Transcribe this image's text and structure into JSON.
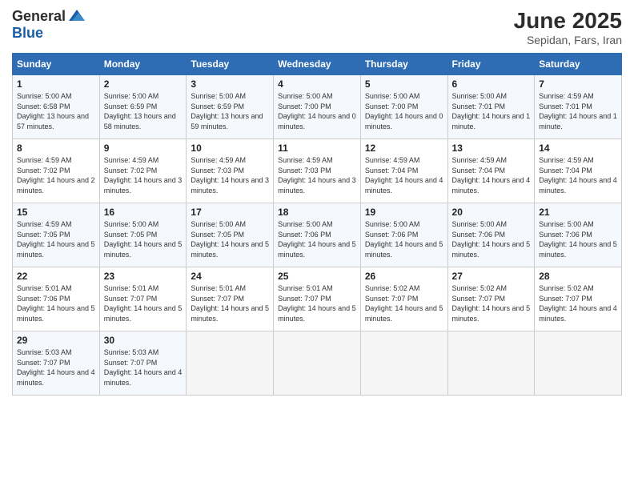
{
  "header": {
    "logo_general": "General",
    "logo_blue": "Blue",
    "title": "June 2025",
    "location": "Sepidan, Fars, Iran"
  },
  "weekdays": [
    "Sunday",
    "Monday",
    "Tuesday",
    "Wednesday",
    "Thursday",
    "Friday",
    "Saturday"
  ],
  "weeks": [
    [
      {
        "day": "1",
        "sunrise": "Sunrise: 5:00 AM",
        "sunset": "Sunset: 6:58 PM",
        "daylight": "Daylight: 13 hours and 57 minutes."
      },
      {
        "day": "2",
        "sunrise": "Sunrise: 5:00 AM",
        "sunset": "Sunset: 6:59 PM",
        "daylight": "Daylight: 13 hours and 58 minutes."
      },
      {
        "day": "3",
        "sunrise": "Sunrise: 5:00 AM",
        "sunset": "Sunset: 6:59 PM",
        "daylight": "Daylight: 13 hours and 59 minutes."
      },
      {
        "day": "4",
        "sunrise": "Sunrise: 5:00 AM",
        "sunset": "Sunset: 7:00 PM",
        "daylight": "Daylight: 14 hours and 0 minutes."
      },
      {
        "day": "5",
        "sunrise": "Sunrise: 5:00 AM",
        "sunset": "Sunset: 7:00 PM",
        "daylight": "Daylight: 14 hours and 0 minutes."
      },
      {
        "day": "6",
        "sunrise": "Sunrise: 5:00 AM",
        "sunset": "Sunset: 7:01 PM",
        "daylight": "Daylight: 14 hours and 1 minute."
      },
      {
        "day": "7",
        "sunrise": "Sunrise: 4:59 AM",
        "sunset": "Sunset: 7:01 PM",
        "daylight": "Daylight: 14 hours and 1 minute."
      }
    ],
    [
      {
        "day": "8",
        "sunrise": "Sunrise: 4:59 AM",
        "sunset": "Sunset: 7:02 PM",
        "daylight": "Daylight: 14 hours and 2 minutes."
      },
      {
        "day": "9",
        "sunrise": "Sunrise: 4:59 AM",
        "sunset": "Sunset: 7:02 PM",
        "daylight": "Daylight: 14 hours and 3 minutes."
      },
      {
        "day": "10",
        "sunrise": "Sunrise: 4:59 AM",
        "sunset": "Sunset: 7:03 PM",
        "daylight": "Daylight: 14 hours and 3 minutes."
      },
      {
        "day": "11",
        "sunrise": "Sunrise: 4:59 AM",
        "sunset": "Sunset: 7:03 PM",
        "daylight": "Daylight: 14 hours and 3 minutes."
      },
      {
        "day": "12",
        "sunrise": "Sunrise: 4:59 AM",
        "sunset": "Sunset: 7:04 PM",
        "daylight": "Daylight: 14 hours and 4 minutes."
      },
      {
        "day": "13",
        "sunrise": "Sunrise: 4:59 AM",
        "sunset": "Sunset: 7:04 PM",
        "daylight": "Daylight: 14 hours and 4 minutes."
      },
      {
        "day": "14",
        "sunrise": "Sunrise: 4:59 AM",
        "sunset": "Sunset: 7:04 PM",
        "daylight": "Daylight: 14 hours and 4 minutes."
      }
    ],
    [
      {
        "day": "15",
        "sunrise": "Sunrise: 4:59 AM",
        "sunset": "Sunset: 7:05 PM",
        "daylight": "Daylight: 14 hours and 5 minutes."
      },
      {
        "day": "16",
        "sunrise": "Sunrise: 5:00 AM",
        "sunset": "Sunset: 7:05 PM",
        "daylight": "Daylight: 14 hours and 5 minutes."
      },
      {
        "day": "17",
        "sunrise": "Sunrise: 5:00 AM",
        "sunset": "Sunset: 7:05 PM",
        "daylight": "Daylight: 14 hours and 5 minutes."
      },
      {
        "day": "18",
        "sunrise": "Sunrise: 5:00 AM",
        "sunset": "Sunset: 7:06 PM",
        "daylight": "Daylight: 14 hours and 5 minutes."
      },
      {
        "day": "19",
        "sunrise": "Sunrise: 5:00 AM",
        "sunset": "Sunset: 7:06 PM",
        "daylight": "Daylight: 14 hours and 5 minutes."
      },
      {
        "day": "20",
        "sunrise": "Sunrise: 5:00 AM",
        "sunset": "Sunset: 7:06 PM",
        "daylight": "Daylight: 14 hours and 5 minutes."
      },
      {
        "day": "21",
        "sunrise": "Sunrise: 5:00 AM",
        "sunset": "Sunset: 7:06 PM",
        "daylight": "Daylight: 14 hours and 5 minutes."
      }
    ],
    [
      {
        "day": "22",
        "sunrise": "Sunrise: 5:01 AM",
        "sunset": "Sunset: 7:06 PM",
        "daylight": "Daylight: 14 hours and 5 minutes."
      },
      {
        "day": "23",
        "sunrise": "Sunrise: 5:01 AM",
        "sunset": "Sunset: 7:07 PM",
        "daylight": "Daylight: 14 hours and 5 minutes."
      },
      {
        "day": "24",
        "sunrise": "Sunrise: 5:01 AM",
        "sunset": "Sunset: 7:07 PM",
        "daylight": "Daylight: 14 hours and 5 minutes."
      },
      {
        "day": "25",
        "sunrise": "Sunrise: 5:01 AM",
        "sunset": "Sunset: 7:07 PM",
        "daylight": "Daylight: 14 hours and 5 minutes."
      },
      {
        "day": "26",
        "sunrise": "Sunrise: 5:02 AM",
        "sunset": "Sunset: 7:07 PM",
        "daylight": "Daylight: 14 hours and 5 minutes."
      },
      {
        "day": "27",
        "sunrise": "Sunrise: 5:02 AM",
        "sunset": "Sunset: 7:07 PM",
        "daylight": "Daylight: 14 hours and 5 minutes."
      },
      {
        "day": "28",
        "sunrise": "Sunrise: 5:02 AM",
        "sunset": "Sunset: 7:07 PM",
        "daylight": "Daylight: 14 hours and 4 minutes."
      }
    ],
    [
      {
        "day": "29",
        "sunrise": "Sunrise: 5:03 AM",
        "sunset": "Sunset: 7:07 PM",
        "daylight": "Daylight: 14 hours and 4 minutes."
      },
      {
        "day": "30",
        "sunrise": "Sunrise: 5:03 AM",
        "sunset": "Sunset: 7:07 PM",
        "daylight": "Daylight: 14 hours and 4 minutes."
      },
      null,
      null,
      null,
      null,
      null
    ]
  ]
}
